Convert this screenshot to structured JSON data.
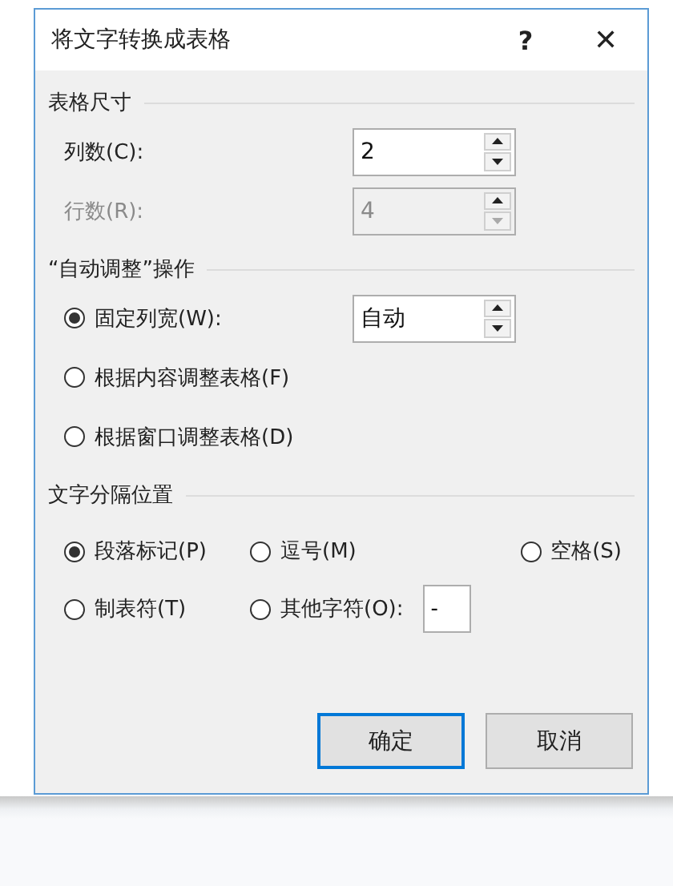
{
  "window": {
    "title": "将文字转换成表格",
    "help": "?",
    "close": "✕"
  },
  "table_size": {
    "title": "表格尺寸",
    "fields": [
      {
        "label": "列数(C):",
        "value": "2",
        "disabled": false
      },
      {
        "label": "行数(R):",
        "value": "4",
        "disabled": true
      }
    ]
  },
  "autofit": {
    "title": "“自动调整”操作",
    "options": [
      {
        "label": "固定列宽(W):",
        "selected": true,
        "spinner_value": "自动"
      },
      {
        "label": "根据内容调整表格(F)",
        "selected": false
      },
      {
        "label": "根据窗口调整表格(D)",
        "selected": false
      }
    ]
  },
  "separator": {
    "title": "文字分隔位置",
    "options": [
      {
        "label": "段落标记(P)",
        "selected": true
      },
      {
        "label": "逗号(M)",
        "selected": false
      },
      {
        "label": "空格(S)",
        "selected": false
      },
      {
        "label": "制表符(T)",
        "selected": false
      },
      {
        "label": "其他字符(O):",
        "selected": false,
        "input_value": "-"
      }
    ]
  },
  "buttons": [
    {
      "label": "确定",
      "default": true
    },
    {
      "label": "取消",
      "default": false
    }
  ]
}
